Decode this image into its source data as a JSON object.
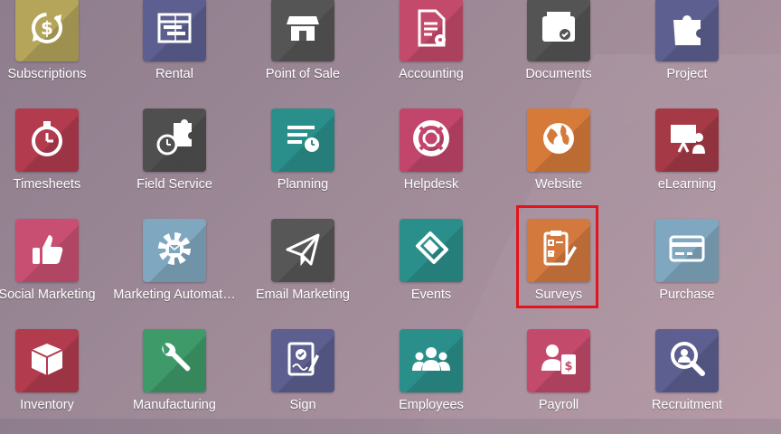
{
  "highlight_color": "#e3141d",
  "apps": [
    {
      "label": "Subscriptions",
      "icon": "subscriptions-icon",
      "color": "#b4a55a"
    },
    {
      "label": "Rental",
      "icon": "rental-icon",
      "color": "#5c5f8f"
    },
    {
      "label": "Point of Sale",
      "icon": "point-of-sale-icon",
      "color": "#555555"
    },
    {
      "label": "Accounting",
      "icon": "accounting-icon",
      "color": "#c44a6b"
    },
    {
      "label": "Documents",
      "icon": "documents-icon",
      "color": "#545454"
    },
    {
      "label": "Project",
      "icon": "project-icon",
      "color": "#5c5f8f"
    },
    {
      "label": "Timesheets",
      "icon": "timesheets-icon",
      "color": "#b23b4e"
    },
    {
      "label": "Field Service",
      "icon": "field-service-icon",
      "color": "#4f4f4f"
    },
    {
      "label": "Planning",
      "icon": "planning-icon",
      "color": "#2a8f8a"
    },
    {
      "label": "Helpdesk",
      "icon": "helpdesk-icon",
      "color": "#c2456b"
    },
    {
      "label": "Website",
      "icon": "website-icon",
      "color": "#d67a3a"
    },
    {
      "label": "eLearning",
      "icon": "elearning-icon",
      "color": "#a53a46"
    },
    {
      "label": "Social Marketing",
      "icon": "social-marketing-icon",
      "color": "#c94f72"
    },
    {
      "label": "Marketing Automat…",
      "icon": "marketing-automation-icon",
      "color": "#7fa7bf"
    },
    {
      "label": "Email Marketing",
      "icon": "email-marketing-icon",
      "color": "#575757"
    },
    {
      "label": "Events",
      "icon": "events-icon",
      "color": "#2a8f8a"
    },
    {
      "label": "Surveys",
      "icon": "surveys-icon",
      "color": "#d3793d"
    },
    {
      "label": "Purchase",
      "icon": "purchase-icon",
      "color": "#7fa7bf"
    },
    {
      "label": "Inventory",
      "icon": "inventory-icon",
      "color": "#b23b4e"
    },
    {
      "label": "Manufacturing",
      "icon": "manufacturing-icon",
      "color": "#3f9a6a"
    },
    {
      "label": "Sign",
      "icon": "sign-icon",
      "color": "#5c5f8f"
    },
    {
      "label": "Employees",
      "icon": "employees-icon",
      "color": "#2a8f8a"
    },
    {
      "label": "Payroll",
      "icon": "payroll-icon",
      "color": "#c44a6b"
    },
    {
      "label": "Recruitment",
      "icon": "recruitment-icon",
      "color": "#5c5f8f"
    }
  ]
}
